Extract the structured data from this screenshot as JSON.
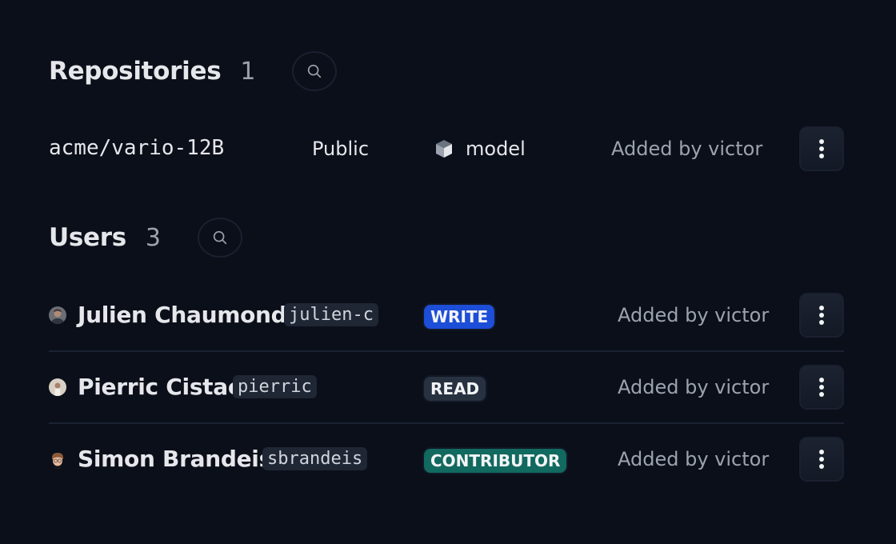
{
  "repositories": {
    "title": "Repositories",
    "count": "1",
    "items": [
      {
        "name": "acme/vario-12B",
        "visibility": "Public",
        "type": "model",
        "type_icon": "cube-icon",
        "added_by": "Added by victor"
      }
    ]
  },
  "users": {
    "title": "Users",
    "count": "3",
    "items": [
      {
        "full_name": "Julien Chaumond",
        "username": "julien-c",
        "role": "WRITE",
        "role_color": "#1d4ed8",
        "added_by": "Added by victor"
      },
      {
        "full_name": "Pierric Cistac",
        "username": "pierric",
        "role": "READ",
        "role_color": "#283140",
        "added_by": "Added by victor"
      },
      {
        "full_name": "Simon Brandeis",
        "username": "sbrandeis",
        "role": "CONTRIBUTOR",
        "role_color": "#11695f",
        "added_by": "Added by victor"
      }
    ]
  },
  "icons": {
    "search": "search-icon",
    "more": "more-vertical-icon"
  }
}
